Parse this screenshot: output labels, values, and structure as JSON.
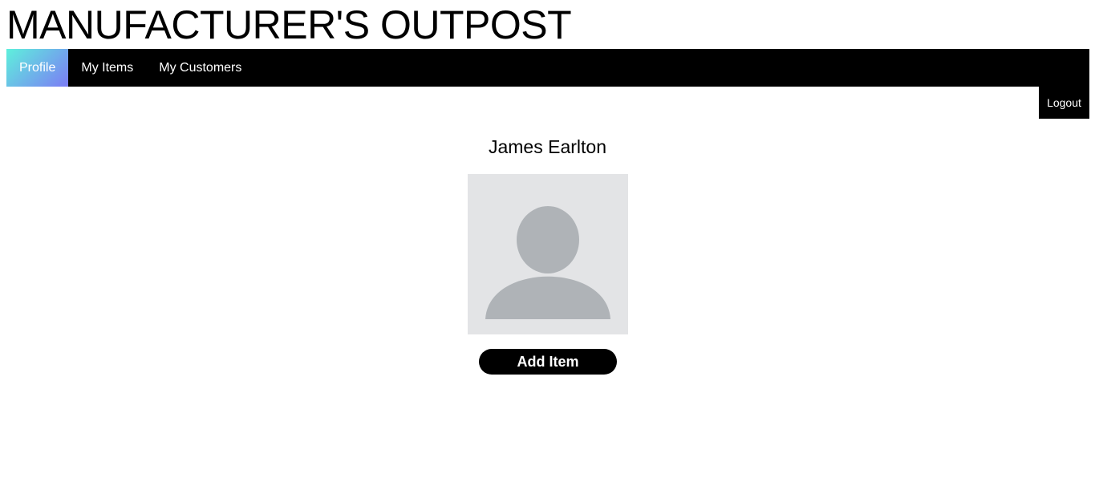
{
  "site": {
    "title": "MANUFACTURER'S OUTPOST"
  },
  "nav": {
    "items": [
      {
        "label": "Profile",
        "active": true
      },
      {
        "label": "My Items",
        "active": false
      },
      {
        "label": "My Customers",
        "active": false
      }
    ]
  },
  "header": {
    "logout_label": "Logout"
  },
  "profile": {
    "name": "James Earlton",
    "avatar_icon": "user-placeholder-icon",
    "add_item_label": "Add Item"
  },
  "colors": {
    "nav_background": "#000000",
    "active_tab_gradient_start": "#5ef0dc",
    "active_tab_gradient_end": "#7c7cf5",
    "avatar_background": "#e3e4e6",
    "avatar_silhouette": "#afb3b7"
  }
}
